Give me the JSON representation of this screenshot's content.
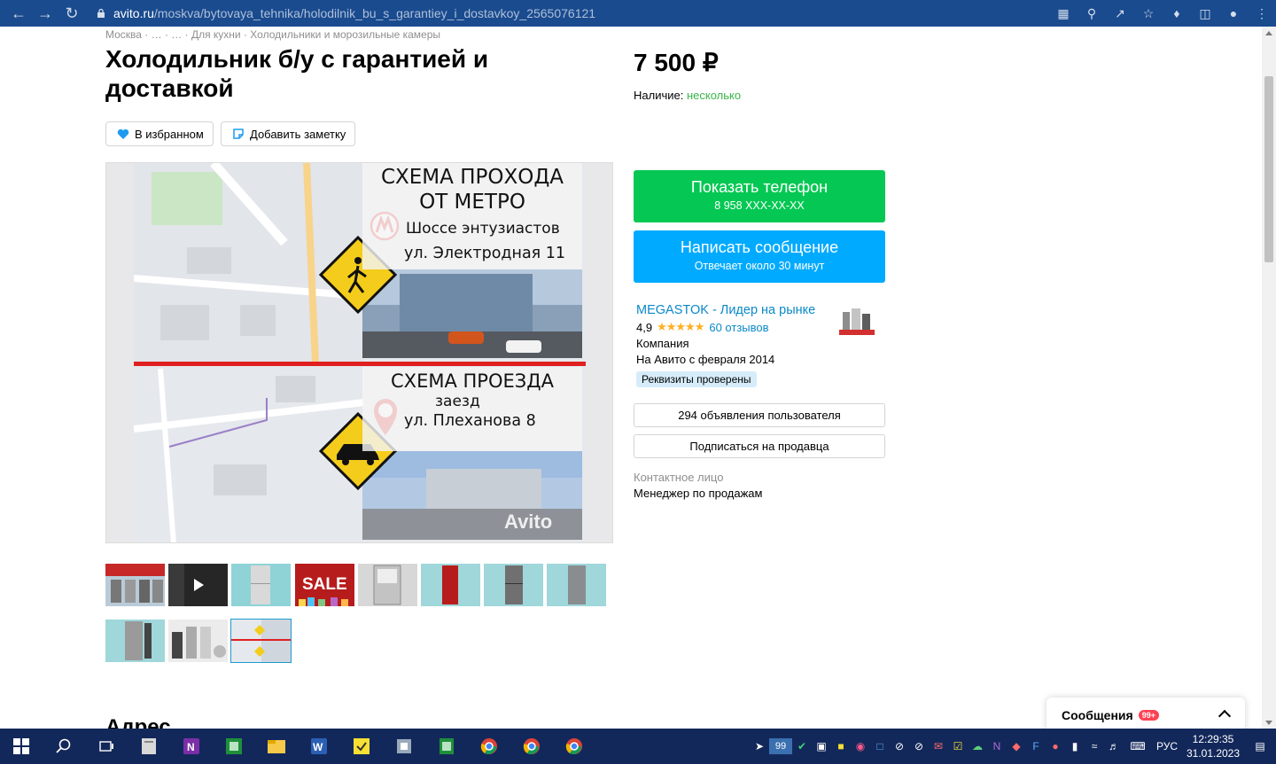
{
  "browser": {
    "url_host": "avito.ru",
    "url_path": "/moskva/bytovaya_tehnika/holodilnik_bu_s_garantiey_i_dostavkoy_2565076121"
  },
  "breadcrumbs": "Москва · … · … · Для кухни · Холодильники и морозильные камеры",
  "listing": {
    "title": "Холодильник б/у с гарантией и доставкой",
    "favorite_label": "В избранном",
    "note_label": "Добавить заметку",
    "price": "7 500 ₽",
    "stock_label": "Наличие:",
    "stock_value": "несколько"
  },
  "photo": {
    "line1": "СХЕМА ПРОХОДА",
    "line2": "ОТ МЕТРО",
    "metro_station": "Шоссе энтузиастов",
    "walk_address": "ул. Электродная 11",
    "line3": "СХЕМА ПРОЕЗДА",
    "entry_word": "заезд",
    "drive_address": "ул. Плеханова 8",
    "watermark": "Avito",
    "thumb_sale_text": "SALE"
  },
  "contact": {
    "phone_button": "Показать телефон",
    "phone_masked": "8 958 XXX-XX-XX",
    "message_button": "Написать сообщение",
    "message_sub": "Отвечает около 30 минут"
  },
  "seller": {
    "name": "MEGASTOK - Лидер на рынке",
    "rating": "4,9",
    "reviews": "60 отзывов",
    "type": "Компания",
    "since": "На Авито с февраля 2014",
    "verified": "Реквизиты проверены",
    "ads_button": "294 объявления пользователя",
    "subscribe_button": "Подписаться на продавца",
    "contact_label": "Контактное лицо",
    "contact_value": "Менеджер по продажам"
  },
  "address_heading": "Адрес",
  "messages": {
    "label": "Сообщения",
    "badge": "99+"
  },
  "taskbar": {
    "lang": "РУС",
    "time": "12:29:35",
    "date": "31.01.2023",
    "tray_badge": "99"
  },
  "colors": {
    "green": "#04c853",
    "blue": "#00aaff",
    "link": "#0a88c9",
    "chrome": "#1a4b8f",
    "taskbar": "#13285a"
  }
}
